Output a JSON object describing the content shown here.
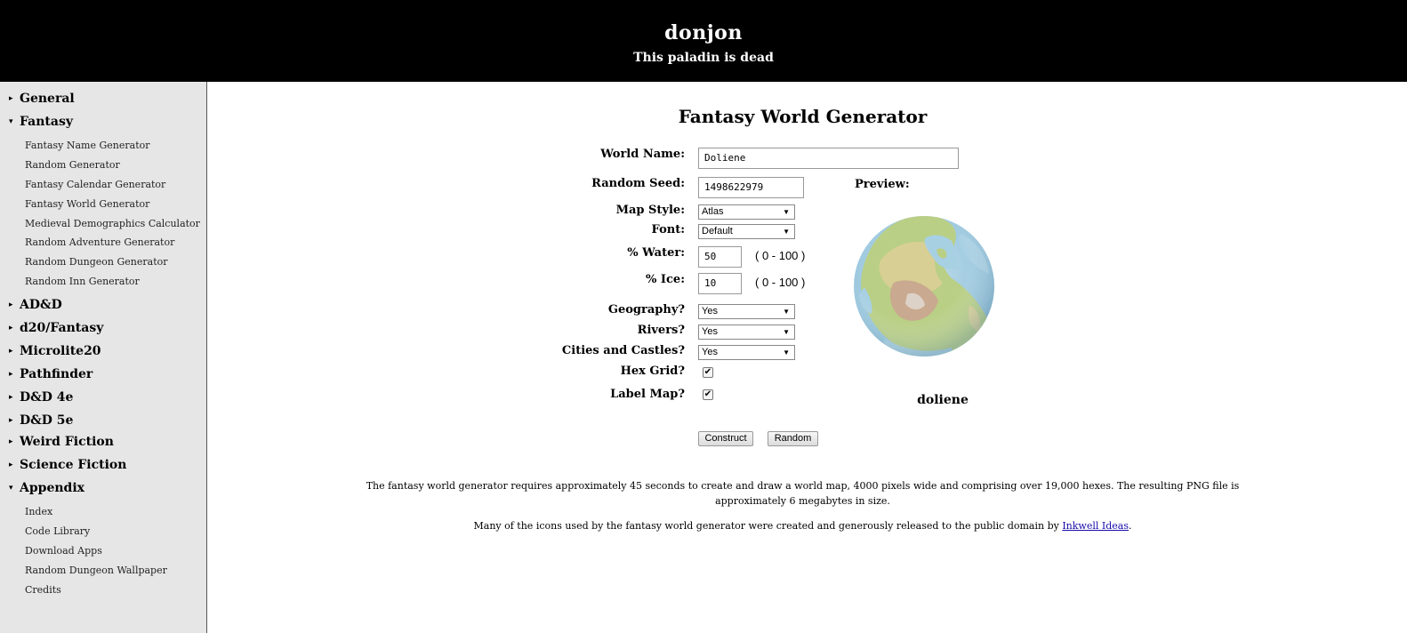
{
  "header": {
    "title": "donjon",
    "subtitle": "This paladin is dead"
  },
  "sidebar": {
    "sections": [
      {
        "label": "General",
        "expanded": false
      },
      {
        "label": "Fantasy",
        "expanded": true,
        "items": [
          "Fantasy Name Generator",
          "Random Generator",
          "Fantasy Calendar Generator",
          "Fantasy World Generator",
          "Medieval Demographics Calculator",
          "Random Adventure Generator",
          "Random Dungeon Generator",
          "Random Inn Generator"
        ]
      },
      {
        "label": "AD&D",
        "expanded": false
      },
      {
        "label": "d20/Fantasy",
        "expanded": false
      },
      {
        "label": "Microlite20",
        "expanded": false
      },
      {
        "label": "Pathfinder",
        "expanded": false
      },
      {
        "label": "D&D 4e",
        "expanded": false
      },
      {
        "label": "D&D 5e",
        "expanded": false
      },
      {
        "label": "Weird Fiction",
        "expanded": false
      },
      {
        "label": "Science Fiction",
        "expanded": false
      },
      {
        "label": "Appendix",
        "expanded": true,
        "items": [
          "Index",
          "Code Library",
          "Download Apps",
          "Random Dungeon Wallpaper",
          "Credits"
        ]
      }
    ]
  },
  "main": {
    "title": "Fantasy World Generator",
    "form": {
      "world_name": {
        "label": "World Name:",
        "value": "Doliene"
      },
      "random_seed": {
        "label": "Random Seed:",
        "value": "1498622979"
      },
      "map_style": {
        "label": "Map Style:",
        "value": "Atlas"
      },
      "font": {
        "label": "Font:",
        "value": "Default"
      },
      "water": {
        "label": "% Water:",
        "value": "50",
        "range": "( 0 - 100 )"
      },
      "ice": {
        "label": "% Ice:",
        "value": "10",
        "range": "( 0 - 100 )"
      },
      "geography": {
        "label": "Geography?",
        "value": "Yes"
      },
      "rivers": {
        "label": "Rivers?",
        "value": "Yes"
      },
      "cities": {
        "label": "Cities and Castles?",
        "value": "Yes"
      },
      "hex_grid": {
        "label": "Hex Grid?",
        "checked": true
      },
      "label_map": {
        "label": "Label Map?",
        "checked": true
      }
    },
    "preview": {
      "label": "Preview:",
      "map_name": "doliene"
    },
    "buttons": {
      "construct": "Construct",
      "random": "Random"
    },
    "notes": {
      "line1": "The fantasy world generator requires approximately 45 seconds to create and draw a world map, 4000 pixels wide and comprising over 19,000 hexes. The resulting PNG file is approximately 6 megabytes in size.",
      "line2_prefix": "Many of the icons used by the fantasy world generator were created and generously released to the public domain by ",
      "line2_link": "Inkwell Ideas",
      "line2_suffix": "."
    }
  },
  "colors": {
    "header_bg": "#000000",
    "sidebar_bg": "#e6e6e6",
    "water": "#9cc8de",
    "land": "#b9cf85",
    "highland": "#c9a98f",
    "link": "#1a0dab"
  }
}
